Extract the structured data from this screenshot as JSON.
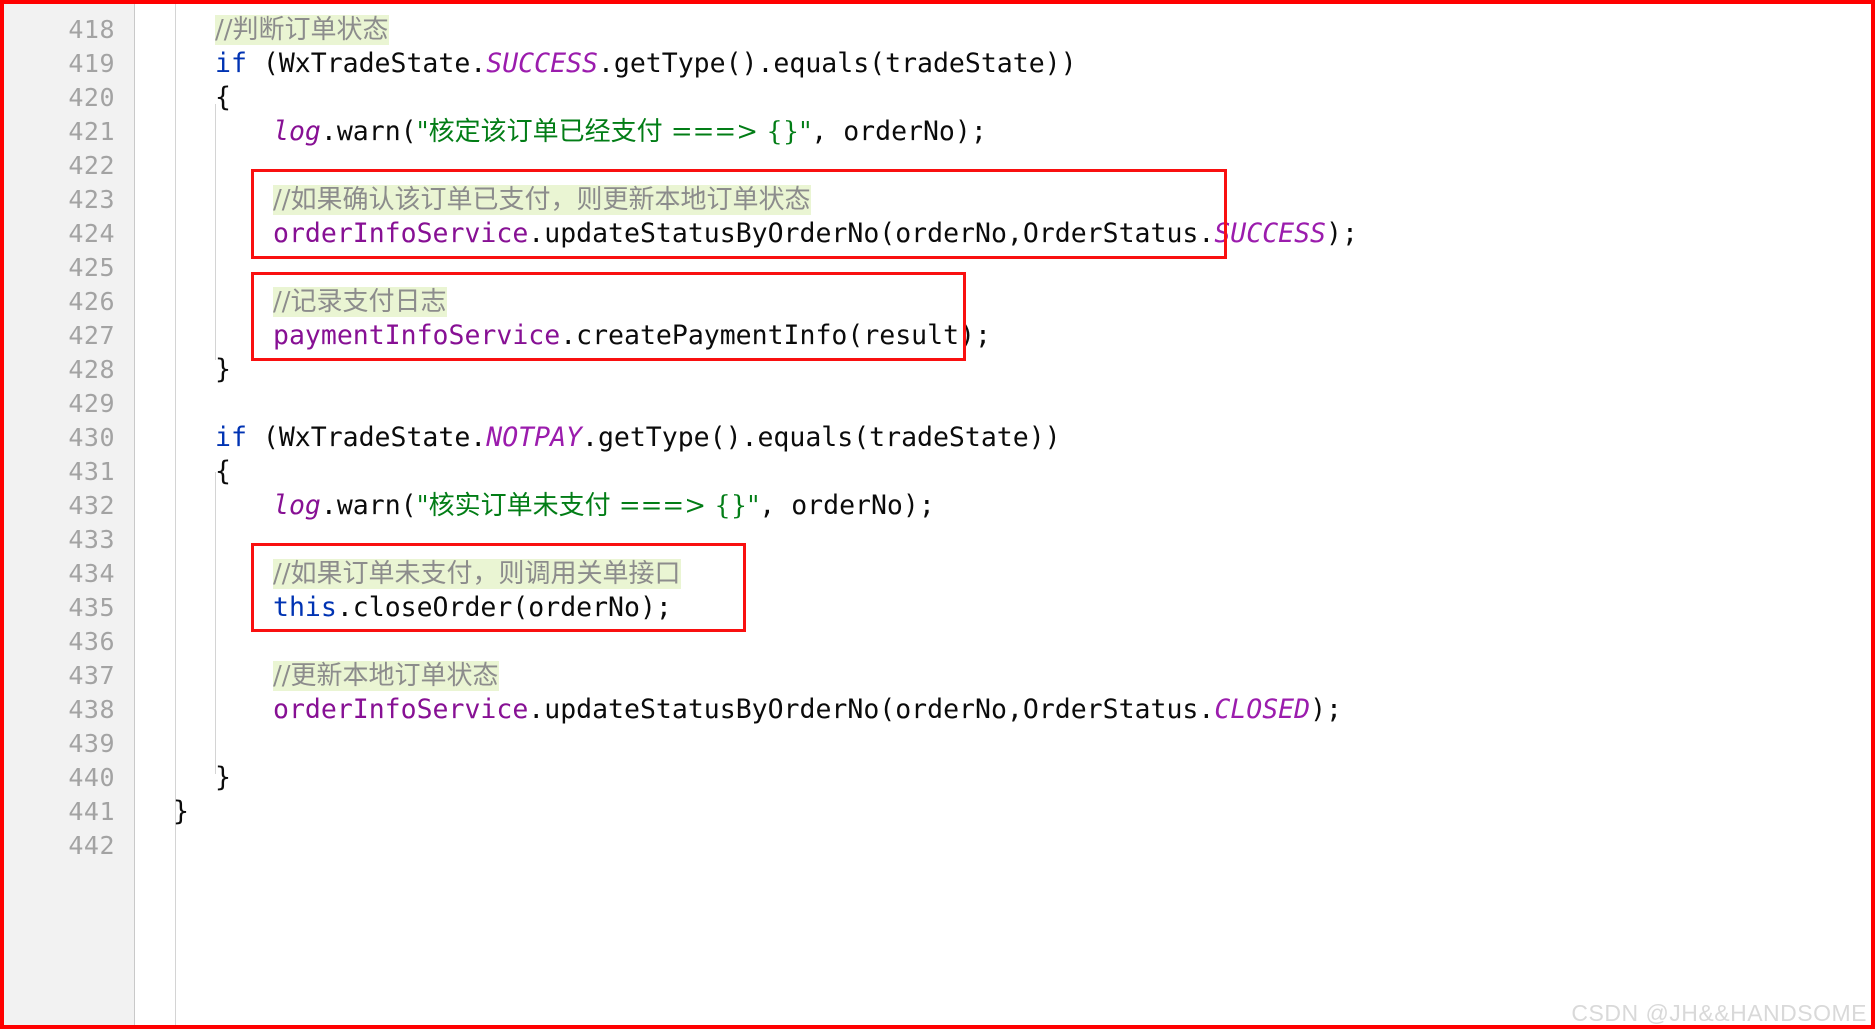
{
  "editor": {
    "language": "java",
    "first_line": 418,
    "last_line": 442,
    "colors": {
      "keyword": "#0033b3",
      "string": "#027d16",
      "field": "#871094",
      "static_constant": "#9b1cad",
      "comment_text": "#8c8c8c",
      "comment_highlight": "#eaf5d3",
      "gutter_background": "#f2f2f2",
      "line_number": "#a3a3a3",
      "annotation_red": "#f91010",
      "capture_border": "#ff0000"
    }
  },
  "lines": [
    {
      "n": "418",
      "indent": 0
    },
    {
      "n": "419",
      "indent": 0
    },
    {
      "n": "420",
      "indent": 0
    },
    {
      "n": "421",
      "indent": 0
    },
    {
      "n": "422",
      "indent": 0
    },
    {
      "n": "423",
      "indent": 0
    },
    {
      "n": "424",
      "indent": 0
    },
    {
      "n": "425",
      "indent": 0
    },
    {
      "n": "426",
      "indent": 0
    },
    {
      "n": "427",
      "indent": 0
    },
    {
      "n": "428",
      "indent": 0
    },
    {
      "n": "429",
      "indent": 0
    },
    {
      "n": "430",
      "indent": 0
    },
    {
      "n": "431",
      "indent": 0
    },
    {
      "n": "432",
      "indent": 0
    },
    {
      "n": "433",
      "indent": 0
    },
    {
      "n": "434",
      "indent": 0
    },
    {
      "n": "435",
      "indent": 0
    },
    {
      "n": "436",
      "indent": 0
    },
    {
      "n": "437",
      "indent": 0
    },
    {
      "n": "438",
      "indent": 0
    },
    {
      "n": "439",
      "indent": 0
    },
    {
      "n": "440",
      "indent": 0
    },
    {
      "n": "441",
      "indent": 0
    },
    {
      "n": "442",
      "indent": 0
    }
  ],
  "code": {
    "l418_comment": "//判断订单状态",
    "l419_kw": "if",
    "l419_a": " (WxTradeState.",
    "l419_const": "SUCCESS",
    "l419_b": ".getType().equals(tradeState))",
    "l420_brace": "{",
    "l421_log": "log",
    "l421_a": ".warn(",
    "l421_str": "\"核定该订单已经支付 ===> {}\"",
    "l421_b": ", orderNo);",
    "l423_comment": "//如果确认该订单已支付，则更新本地订单状态",
    "l424_field": "orderInfoService",
    "l424_a": ".updateStatusByOrderNo(orderNo,OrderStatus.",
    "l424_const": "SUCCESS",
    "l424_b": ");",
    "l426_comment": "//记录支付日志",
    "l427_field": "paymentInfoService",
    "l427_a": ".createPaymentInfo(result);",
    "l428_brace": "}",
    "l430_kw": "if",
    "l430_a": " (WxTradeState.",
    "l430_const": "NOTPAY",
    "l430_b": ".getType().equals(tradeState))",
    "l431_brace": "{",
    "l432_log": "log",
    "l432_a": ".warn(",
    "l432_str": "\"核实订单未支付 ===> {}\"",
    "l432_b": ", orderNo);",
    "l434_comment": "//如果订单未支付，则调用关单接口",
    "l435_kw": "this",
    "l435_a": ".closeOrder(orderNo);",
    "l437_comment": "//更新本地订单状态",
    "l438_field": "orderInfoService",
    "l438_a": ".updateStatusByOrderNo(orderNo,OrderStatus.",
    "l438_const": "CLOSED",
    "l438_b": ");",
    "l440_brace": "}",
    "l441_brace": "}"
  },
  "annotations": {
    "box1_label": "update-order-status-annotation",
    "box2_label": "record-payment-log-annotation",
    "box3_label": "close-order-annotation"
  },
  "watermark": {
    "text": "CSDN @JH&&HANDSOME"
  }
}
